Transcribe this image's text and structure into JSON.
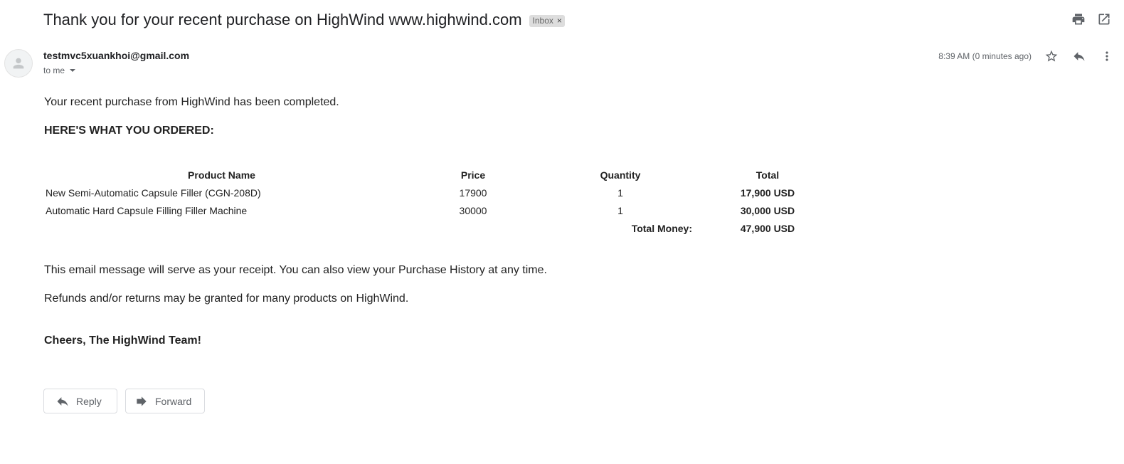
{
  "subject": {
    "title": "Thank you for your recent purchase on HighWind www.highwind.com",
    "label": "Inbox",
    "label_remove": "×"
  },
  "header_actions": {
    "icons": [
      "print-icon",
      "open-in-new-window-icon"
    ]
  },
  "message": {
    "sender": "testmvc5xuankhoi@gmail.com",
    "recipient": "to me",
    "timestamp": "8:39 AM (0 minutes ago)",
    "meta_icons": [
      "star-icon",
      "reply-icon",
      "more-options-icon"
    ]
  },
  "email_body": {
    "intro": "Your recent purchase from HighWind has been completed.",
    "ordered_heading": "HERE'S WHAT YOU ORDERED:",
    "table": {
      "headers": [
        "Product Name",
        "Price",
        "Quantity",
        "Total"
      ],
      "rows": [
        [
          "New Semi-Automatic Capsule Filler (CGN-208D)",
          "17900",
          "1",
          "17,900 USD"
        ],
        [
          "Automatic Hard Capsule Filling Filler Machine",
          "30000",
          "1",
          "30,000 USD"
        ]
      ],
      "total_label": "Total Money:",
      "total_value": "47,900 USD"
    },
    "receipt_note": "This email message will serve as your receipt. You can also view your Purchase History at any time.",
    "refund_note": "Refunds and/or returns may be granted for many products on HighWind.",
    "signoff": "Cheers, The HighWind Team!"
  },
  "footer_actions": {
    "reply_label": "Reply",
    "forward_label": "Forward"
  }
}
